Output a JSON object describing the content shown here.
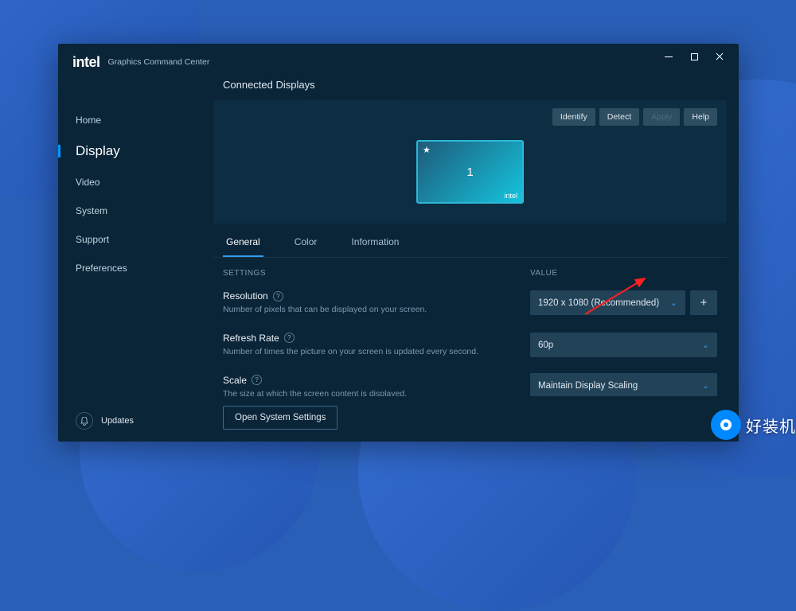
{
  "app": {
    "brand": "intel",
    "title": "Graphics Command Center"
  },
  "sidebar": {
    "items": [
      {
        "label": "Home"
      },
      {
        "label": "Display"
      },
      {
        "label": "Video"
      },
      {
        "label": "System"
      },
      {
        "label": "Support"
      },
      {
        "label": "Preferences"
      }
    ],
    "footer_label": "Updates"
  },
  "main": {
    "title": "Connected Displays",
    "actions": {
      "identify": "Identify",
      "detect": "Detect",
      "apply": "Apply",
      "help": "Help"
    },
    "monitor": {
      "number": "1",
      "brand": "intel"
    },
    "tabs": [
      {
        "label": "General"
      },
      {
        "label": "Color"
      },
      {
        "label": "Information"
      }
    ],
    "headers": {
      "settings": "SETTINGS",
      "value": "VALUE"
    },
    "settings": [
      {
        "label": "Resolution",
        "desc": "Number of pixels that can be displayed on your screen."
      },
      {
        "label": "Refresh Rate",
        "desc": "Number of times the picture on your screen is updated every second."
      },
      {
        "label": "Scale",
        "desc": "The size at which the screen content is displayed."
      }
    ],
    "values": {
      "resolution": "1920 x 1080 (Recommended)",
      "refresh": "60p",
      "scale": "Maintain Display Scaling"
    },
    "sysbtn": "Open System Settings"
  },
  "watermark": "好装机"
}
